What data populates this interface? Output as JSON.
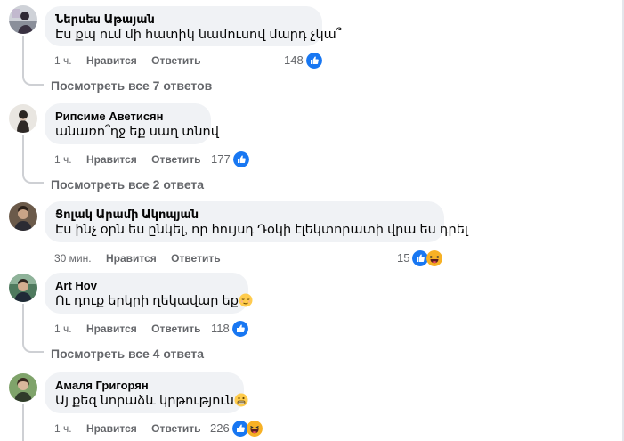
{
  "comments": [
    {
      "author": "Ներսես Աթայան",
      "text": "Էս քպ ում մի հատիկ նամուսով մարդ չկա՞",
      "time": "1 ч.",
      "like_label": "Нравится",
      "reply_label": "Ответить",
      "reactions": "148",
      "view_replies": "Посмотреть все 7 ответов"
    },
    {
      "author": "Рипсиме Аветисян",
      "text": "անառո՞ղջ եք սաղ տնով",
      "time": "1 ч.",
      "like_label": "Нравится",
      "reply_label": "Ответить",
      "reactions": "177",
      "view_replies": "Посмотреть все 2 ответа"
    },
    {
      "author": "Ցոլակ Արամի Ակոպյան",
      "text": "Էս ինչ օրն ես ընկել, որ հույսդ Դօկի էլեկտորատի վրա ես դրել",
      "time": "30 мин.",
      "like_label": "Нравится",
      "reply_label": "Ответить",
      "reactions": "15"
    },
    {
      "author": "Art Hov",
      "text": "Ու դուք երկրի ղեկավար եք",
      "time": "1 ч.",
      "like_label": "Нравится",
      "reply_label": "Ответить",
      "reactions": "118",
      "view_replies": "Посмотреть все 4 ответа"
    },
    {
      "author": "Амаля Григорян",
      "text": "Այ քեզ նորաձև կրթություն",
      "time": "1 ч.",
      "like_label": "Нравится",
      "reply_label": "Ответить",
      "reactions": "226"
    }
  ],
  "colors": {
    "like_blue": "#1877f2",
    "bubble": "#f0f2f5",
    "meta_gray": "#65676b",
    "haha_yellow": "#f7b125"
  },
  "icons": {
    "like": "like-reaction-icon",
    "haha": "haha-reaction-icon",
    "relieved": "relieved-face-emoji",
    "grimace": "grimacing-face-emoji"
  }
}
